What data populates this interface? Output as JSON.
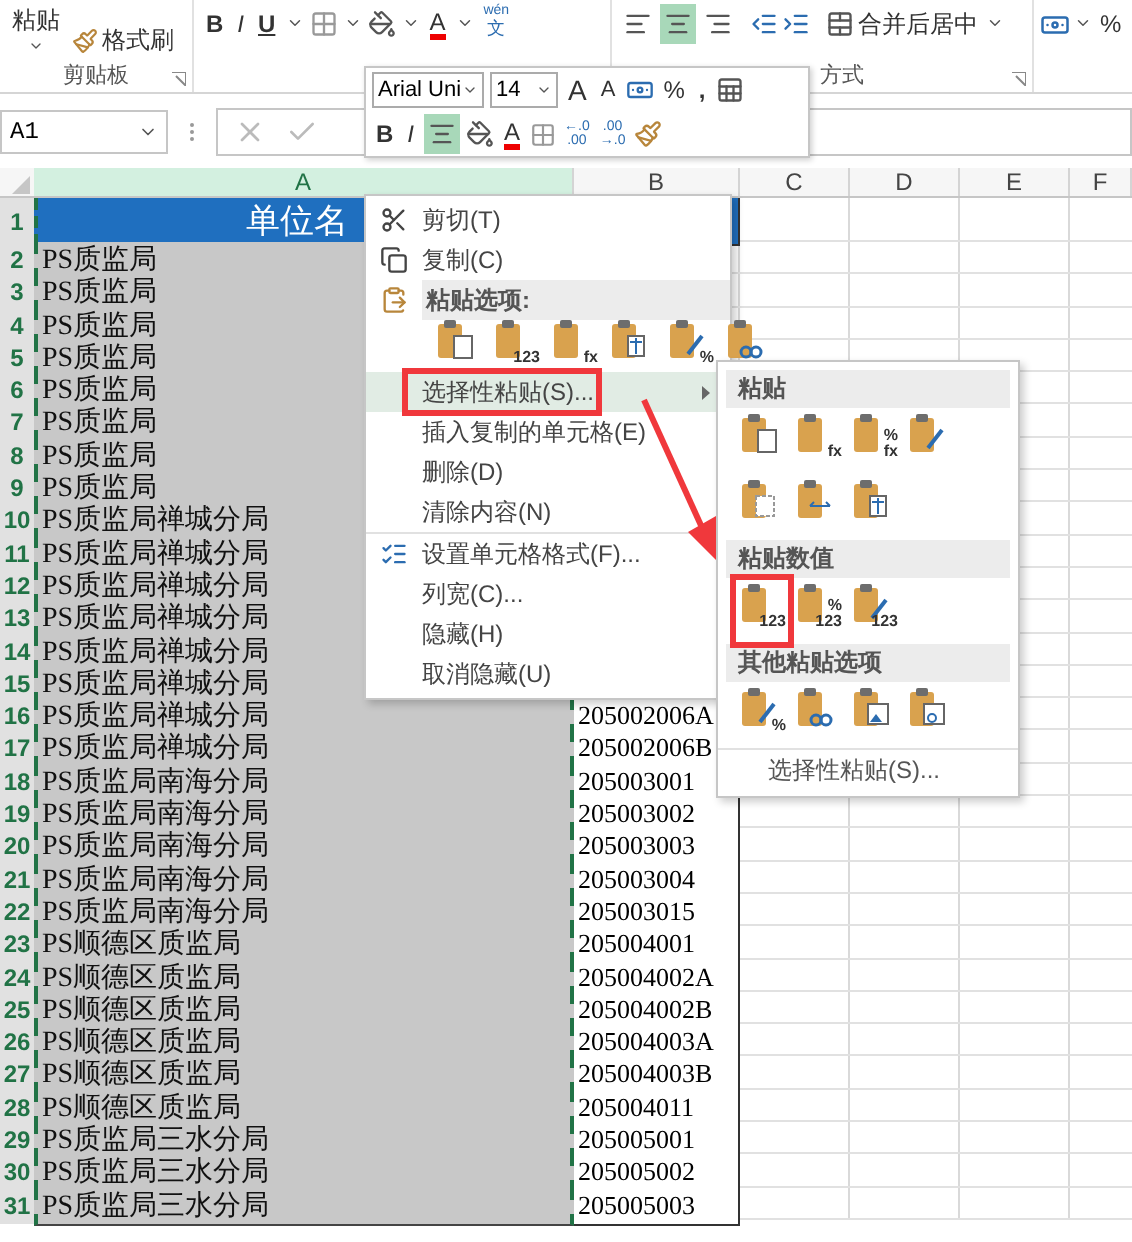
{
  "ribbon": {
    "clipboard": {
      "paste": "粘贴",
      "format_painter": "格式刷",
      "label": "剪贴板"
    },
    "font": {
      "bold": "B",
      "italic": "I",
      "underline": "U",
      "font_color": "A",
      "phonetic_top": "wén",
      "phonetic_bottom": "文"
    },
    "alignment": {
      "buttons": [
        {
          "kind": "left",
          "selected": false
        },
        {
          "kind": "center",
          "selected": true
        },
        {
          "kind": "right",
          "selected": false
        }
      ],
      "merge": "合并后居中",
      "label": "方式"
    },
    "number": {
      "percent": "%"
    }
  },
  "formula_bar": {
    "name_box": "A1"
  },
  "mini_toolbar": {
    "font": "Arial Uni",
    "size": "14",
    "grow": "A",
    "shrink": "A",
    "percent": "%",
    "comma": ",",
    "bold": "B",
    "italic": "I",
    "center_selected": true,
    "font_color": "A",
    "increase_decimal": [
      "←.0",
      ".00"
    ],
    "decrease_decimal": [
      ".00",
      "→.0"
    ]
  },
  "columns": [
    {
      "label": "A",
      "selected": true
    },
    {
      "label": "B",
      "selected": false
    },
    {
      "label": "C",
      "selected": false
    },
    {
      "label": "D",
      "selected": false
    },
    {
      "label": "E",
      "selected": false
    },
    {
      "label": "F",
      "selected": false
    }
  ],
  "rows": [
    {
      "number": "1",
      "kind": "header",
      "selected": true,
      "a": "单位名"
    },
    {
      "number": "2",
      "kind": "data",
      "selected": true,
      "a": "PS质监局"
    },
    {
      "number": "3",
      "kind": "data",
      "selected": true,
      "a": "PS质监局"
    },
    {
      "number": "4",
      "kind": "data",
      "selected": true,
      "a": "PS质监局"
    },
    {
      "number": "5",
      "kind": "data",
      "selected": true,
      "a": "PS质监局"
    },
    {
      "number": "6",
      "kind": "data",
      "selected": true,
      "a": "PS质监局"
    },
    {
      "number": "7",
      "kind": "data",
      "selected": true,
      "a": "PS质监局"
    },
    {
      "number": "8",
      "kind": "data",
      "selected": true,
      "a": "PS质监局"
    },
    {
      "number": "9",
      "kind": "data",
      "selected": true,
      "a": "PS质监局"
    },
    {
      "number": "10",
      "kind": "data",
      "selected": true,
      "a": "PS质监局禅城分局"
    },
    {
      "number": "11",
      "kind": "data",
      "selected": true,
      "a": "PS质监局禅城分局"
    },
    {
      "number": "12",
      "kind": "data",
      "selected": true,
      "a": "PS质监局禅城分局"
    },
    {
      "number": "13",
      "kind": "data",
      "selected": true,
      "a": "PS质监局禅城分局"
    },
    {
      "number": "14",
      "kind": "data",
      "selected": true,
      "a": "PS质监局禅城分局"
    },
    {
      "number": "15",
      "kind": "data",
      "selected": true,
      "a": "PS质监局禅城分局"
    },
    {
      "number": "16",
      "kind": "data",
      "selected": true,
      "a": "PS质监局禅城分局",
      "b": "205002006A"
    },
    {
      "number": "17",
      "kind": "data",
      "selected": true,
      "a": "PS质监局禅城分局",
      "b": "205002006B"
    },
    {
      "number": "18",
      "kind": "data",
      "selected": true,
      "a": "PS质监局南海分局",
      "b": "205003001"
    },
    {
      "number": "19",
      "kind": "data",
      "selected": true,
      "a": "PS质监局南海分局",
      "b": "205003002"
    },
    {
      "number": "20",
      "kind": "data",
      "selected": true,
      "a": "PS质监局南海分局",
      "b": "205003003"
    },
    {
      "number": "21",
      "kind": "data",
      "selected": true,
      "a": "PS质监局南海分局",
      "b": "205003004"
    },
    {
      "number": "22",
      "kind": "data",
      "selected": true,
      "a": "PS质监局南海分局",
      "b": "205003015"
    },
    {
      "number": "23",
      "kind": "data",
      "selected": true,
      "a": "PS顺德区质监局",
      "b": "205004001"
    },
    {
      "number": "24",
      "kind": "data",
      "selected": true,
      "a": "PS顺德区质监局",
      "b": "205004002A"
    },
    {
      "number": "25",
      "kind": "data",
      "selected": true,
      "a": "PS顺德区质监局",
      "b": "205004002B"
    },
    {
      "number": "26",
      "kind": "data",
      "selected": true,
      "a": "PS顺德区质监局",
      "b": "205004003A"
    },
    {
      "number": "27",
      "kind": "data",
      "selected": true,
      "a": "PS顺德区质监局",
      "b": "205004003B"
    },
    {
      "number": "28",
      "kind": "data",
      "selected": true,
      "a": "PS顺德区质监局",
      "b": "205004011"
    },
    {
      "number": "29",
      "kind": "data",
      "selected": true,
      "a": "PS质监局三水分局",
      "b": "205005001"
    },
    {
      "number": "30",
      "kind": "data",
      "selected": true,
      "a": "PS质监局三水分局",
      "b": "205005002"
    },
    {
      "number": "31",
      "kind": "data",
      "selected": true,
      "a": "PS质监局三水分局",
      "b": "205005003"
    }
  ],
  "context_menu": {
    "items": [
      {
        "kind": "cut",
        "label": "剪切(T)",
        "selected": false,
        "annotated": false,
        "divider_above": false
      },
      {
        "kind": "copy",
        "label": "复制(C)",
        "selected": false,
        "annotated": false,
        "divider_above": false
      },
      {
        "kind": "section",
        "label": "粘贴选项:"
      },
      {
        "kind": "paste-row",
        "options": [
          {
            "kind": "paste",
            "annotated": false
          },
          {
            "kind": "values",
            "badges": [
              "123"
            ],
            "annotated": false
          },
          {
            "kind": "formulas",
            "badges": [
              "fx"
            ],
            "annotated": false
          },
          {
            "kind": "transpose",
            "annotated": false
          },
          {
            "kind": "formatting",
            "badges": [
              "%"
            ],
            "annotated": false
          },
          {
            "kind": "link",
            "annotated": false
          }
        ]
      },
      {
        "kind": "submenu",
        "label": "选择性粘贴(S)...",
        "selected": true,
        "annotated": true,
        "divider_above": false
      },
      {
        "kind": "plain",
        "label": "插入复制的单元格(E)",
        "selected": false,
        "annotated": false,
        "divider_above": false
      },
      {
        "kind": "plain",
        "label": "删除(D)",
        "selected": false,
        "annotated": false,
        "divider_above": false
      },
      {
        "kind": "plain",
        "label": "清除内容(N)",
        "selected": false,
        "annotated": false,
        "divider_above": false
      },
      {
        "kind": "format-cells",
        "label": "设置单元格格式(F)...",
        "selected": false,
        "annotated": false,
        "divider_above": true
      },
      {
        "kind": "plain",
        "label": "列宽(C)...",
        "selected": false,
        "annotated": false,
        "divider_above": false
      },
      {
        "kind": "plain",
        "label": "隐藏(H)",
        "selected": false,
        "annotated": false,
        "divider_above": false
      },
      {
        "kind": "plain",
        "label": "取消隐藏(U)",
        "selected": false,
        "annotated": false,
        "divider_above": false
      }
    ]
  },
  "submenu": {
    "sections": [
      {
        "title": "粘贴",
        "rows": [
          [
            {
              "kind": "paste",
              "annotated": false
            },
            {
              "kind": "formulas",
              "badges": [
                "fx"
              ],
              "annotated": false
            },
            {
              "kind": "formulas",
              "badges": [
                "%",
                "fx"
              ],
              "annotated": false
            },
            {
              "kind": "formatting",
              "annotated": false
            }
          ],
          [
            {
              "kind": "no-borders",
              "annotated": false
            },
            {
              "kind": "column-widths",
              "annotated": false
            },
            {
              "kind": "transpose",
              "annotated": false
            }
          ]
        ]
      },
      {
        "title": "粘贴数值",
        "rows": [
          [
            {
              "kind": "values",
              "badges": [
                "123"
              ],
              "annotated": true
            },
            {
              "kind": "values",
              "badges": [
                "%",
                "123"
              ],
              "annotated": false
            },
            {
              "kind": "formatting",
              "badges": [
                "123"
              ],
              "annotated": false
            }
          ]
        ]
      },
      {
        "title": "其他粘贴选项",
        "rows": [
          [
            {
              "kind": "formatting",
              "badges": [
                "%"
              ],
              "annotated": false
            },
            {
              "kind": "link",
              "annotated": false
            },
            {
              "kind": "picture",
              "annotated": false
            },
            {
              "kind": "linked-picture",
              "annotated": false
            }
          ]
        ]
      }
    ],
    "footer": "选择性粘贴(S)..."
  }
}
